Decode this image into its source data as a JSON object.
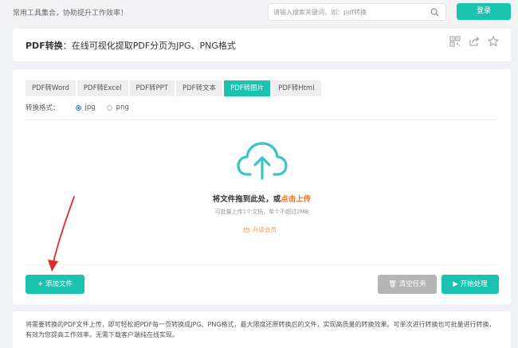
{
  "header": {
    "tagline": "常用工具集合，协助提升工作效率！",
    "search_placeholder": "请输入搜索关键词，如：pdf转换",
    "login_label": "登录"
  },
  "page": {
    "title_bold": "PDF转换",
    "title_rest": "：在线可视化提取PDF分页为JPG、PNG格式",
    "icons": [
      "qrcode-icon",
      "share-icon",
      "star-icon"
    ]
  },
  "tabs": [
    {
      "label": "PDF转Word",
      "active": false
    },
    {
      "label": "PDF转Excel",
      "active": false
    },
    {
      "label": "PDF转PPT",
      "active": false
    },
    {
      "label": "PDF转文本",
      "active": false
    },
    {
      "label": "PDF转图片",
      "active": true
    },
    {
      "label": "PDF转Html",
      "active": false
    }
  ],
  "format": {
    "label": "转换格式：",
    "options": [
      {
        "label": "jpg",
        "selected": true
      },
      {
        "label": "png",
        "selected": false
      }
    ]
  },
  "dropzone": {
    "main_text": "将文件拖到此处，或",
    "upload_link": "点击上传",
    "limit_text": "可批量上传1个文档，单个不超过2MB",
    "upgrade_label": "升级会员",
    "icon": "cloud-upload-icon"
  },
  "actions": {
    "add_file": "添加文件",
    "clear_tasks": "清空任务",
    "start": "开始处理"
  },
  "description": "将需要转换的PDF文件上传，即可轻松把PDF每一页转换成JPG、PNG格式，最大限度还原转换后的文件，实现高质量的转换效果。可单次进行转换也可批量进行转换，有效为您提高工作效率。无需下载客户端纯在线实现。",
  "colors": {
    "accent": "#19c3b0",
    "highlight": "#f0752b",
    "upgrade": "#f0a24b",
    "disabled": "#b5b5b5",
    "annotation_arrow": "#e02b2b"
  }
}
